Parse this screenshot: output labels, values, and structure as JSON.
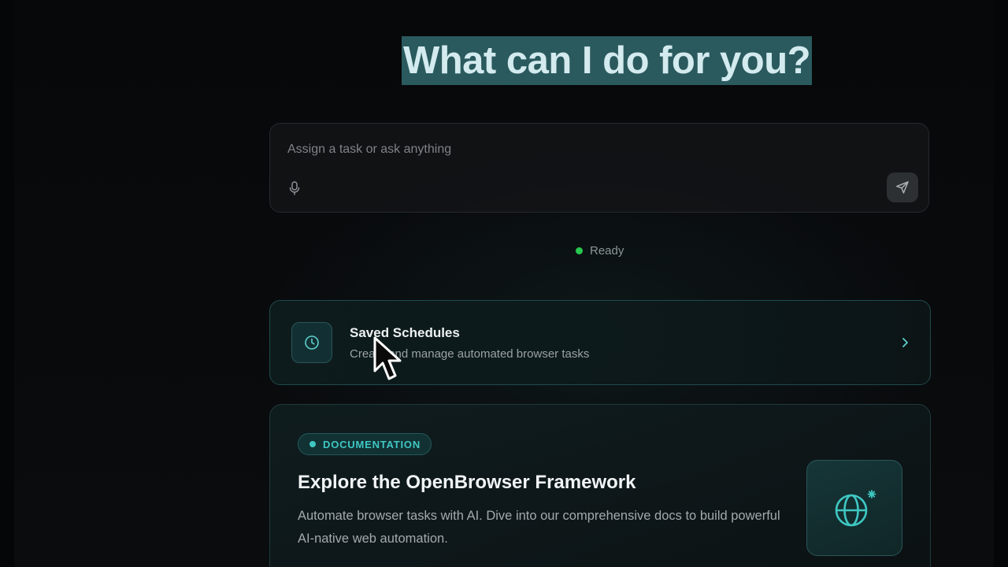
{
  "hero": {
    "title": "What can I do for you?"
  },
  "composer": {
    "placeholder": "Assign a task or ask anything",
    "value": "",
    "mic_icon": "microphone-icon",
    "send_icon": "send-icon"
  },
  "status": {
    "label": "Ready",
    "color": "#27c94f"
  },
  "schedules_card": {
    "icon": "clock-icon",
    "title": "Saved Schedules",
    "description": "Create and manage automated browser tasks",
    "chevron_icon": "chevron-right-icon"
  },
  "docs_card": {
    "badge": "DOCUMENTATION",
    "title": "Explore the OpenBrowser Framework",
    "description": "Automate browser tasks with AI. Dive into our comprehensive docs to build powerful AI-native web automation.",
    "icon": "globe-icon"
  },
  "colors": {
    "accent": "#3fc7c3",
    "title_highlight": "#2a5a5e",
    "background": "#08090a"
  }
}
